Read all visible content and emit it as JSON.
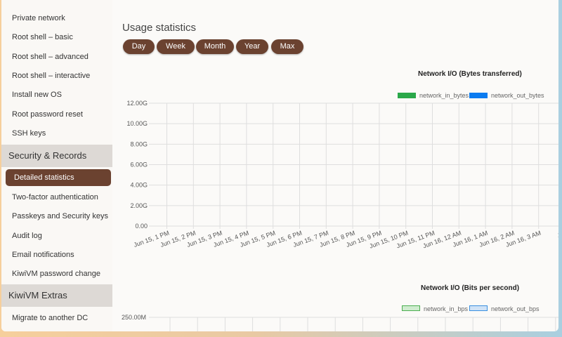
{
  "sidebar": {
    "items_top": [
      "Private network",
      "Root shell – basic",
      "Root shell – advanced",
      "Root shell – interactive",
      "Install new OS",
      "Root password reset",
      "SSH keys"
    ],
    "section_security": "Security & Records",
    "active_item": "Detailed statistics",
    "items_security": [
      "Two-factor authentication",
      "Passkeys and Security keys",
      "Audit log",
      "Email notifications",
      "KiwiVM password change"
    ],
    "section_extras": "KiwiVM Extras",
    "items_extras": [
      "Migrate to another DC"
    ]
  },
  "main": {
    "title": "Usage statistics",
    "ranges": [
      "Day",
      "Week",
      "Month",
      "Year",
      "Max"
    ]
  },
  "colors": {
    "accent": "#6b4230",
    "in_bytes": "#2aa84a",
    "out_bytes": "#0a7cf0",
    "in_bps_fill": "#cfeccf",
    "in_bps_border": "#4caf50",
    "out_bps_fill": "#cfe3f7",
    "out_bps_border": "#3a8fe0"
  },
  "chart_data": [
    {
      "type": "line",
      "title": "Network I/O (Bytes transferred)",
      "series": [
        {
          "name": "network_in_bytes",
          "values": []
        },
        {
          "name": "network_out_bytes",
          "values": []
        }
      ],
      "y_ticks": [
        "0.00",
        "2.00G",
        "4.00G",
        "6.00G",
        "8.00G",
        "10.00G",
        "12.00G"
      ],
      "ylim": [
        0,
        12000000000
      ],
      "x_ticks": [
        "Jun 15, 1 PM",
        "Jun 15, 2 PM",
        "Jun 15, 3 PM",
        "Jun 15, 4 PM",
        "Jun 15, 5 PM",
        "Jun 15, 6 PM",
        "Jun 15, 7 PM",
        "Jun 15, 8 PM",
        "Jun 15, 9 PM",
        "Jun 15, 10 PM",
        "Jun 15, 11 PM",
        "Jun 16, 12 AM",
        "Jun 16, 1 AM",
        "Jun 16, 2 AM",
        "Jun 16, 3 AM",
        "Jun"
      ],
      "grid": true,
      "legend": "top-right"
    },
    {
      "type": "line",
      "title": "Network I/O (Bits per second)",
      "series": [
        {
          "name": "network_in_bps",
          "values": []
        },
        {
          "name": "network_out_bps",
          "values": []
        }
      ],
      "y_ticks": [
        "250.00M"
      ],
      "grid": true,
      "legend": "top-right"
    }
  ]
}
